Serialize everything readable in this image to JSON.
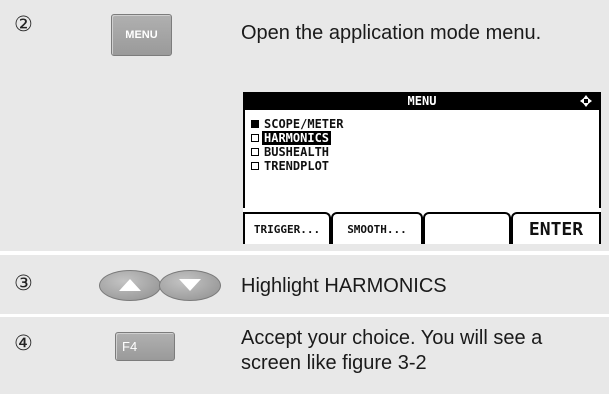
{
  "rows": [
    {
      "step": "②",
      "key_label": "MENU",
      "description": "Open the application mode menu."
    },
    {
      "step": "③",
      "description": "Highlight HARMONICS"
    },
    {
      "step": "④",
      "key_label": "F4",
      "description": "Accept your choice. You will see a screen like figure 3-2"
    }
  ],
  "screen": {
    "title": "MENU",
    "items": [
      {
        "label": "SCOPE/METER",
        "checked": true,
        "highlighted": false
      },
      {
        "label": "HARMONICS",
        "checked": false,
        "highlighted": true
      },
      {
        "label": "BUSHEALTH",
        "checked": false,
        "highlighted": false
      },
      {
        "label": "TRENDPLOT",
        "checked": false,
        "highlighted": false
      }
    ],
    "softkeys": [
      "TRIGGER...",
      "SMOOTH...",
      "",
      "ENTER"
    ]
  },
  "icons": {
    "title_bar": "up-down-left-right-arrows-icon",
    "arrow_up": "triangle-up-icon",
    "arrow_down": "triangle-down-icon"
  },
  "colors": {
    "row_background": "#e8e8e8",
    "key_gray": "#a6a6a6",
    "screen_bar": "#000000"
  }
}
